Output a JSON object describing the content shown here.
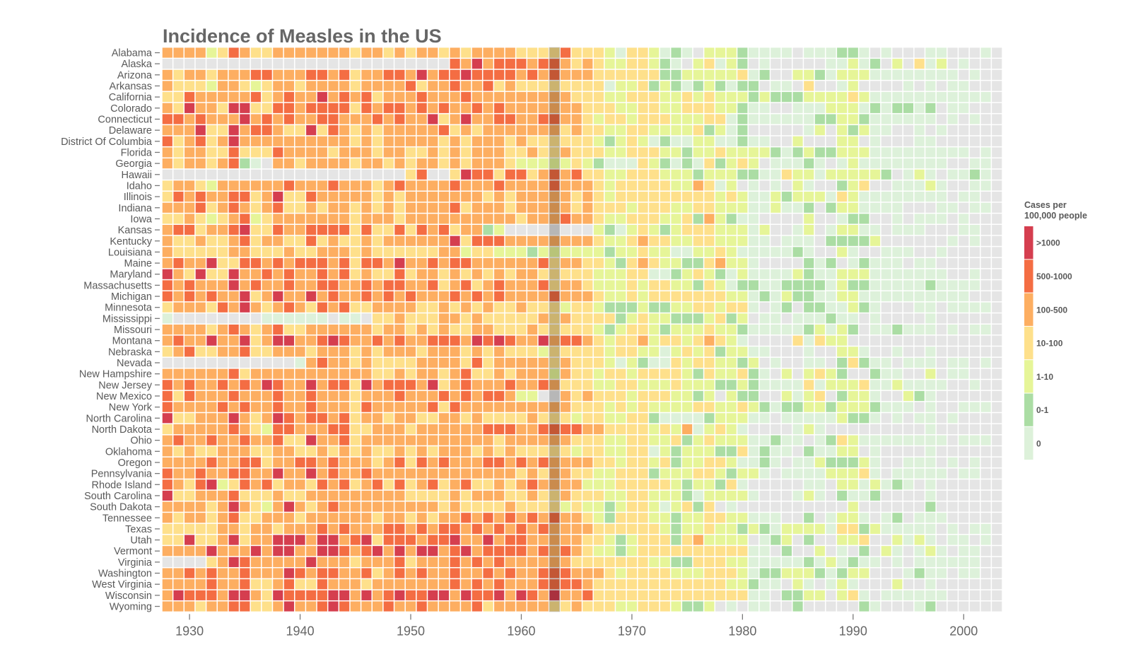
{
  "chart_data": {
    "type": "heatmap",
    "title": "Incidence of Measles in the US",
    "xlabel": "",
    "ylabel": "",
    "year_start": 1928,
    "year_end": 2003,
    "x_ticks": [
      1930,
      1940,
      1950,
      1960,
      1970,
      1980,
      1990,
      2000
    ],
    "highlight_year": 1963,
    "missing": {
      "code": "x",
      "color": "#e5e5e5"
    },
    "legend": {
      "title_lines": [
        "Cases per",
        "100,000 people"
      ],
      "placement": "right",
      "items": [
        {
          "code": "6",
          "label": ">1000",
          "color": "#d53e4f"
        },
        {
          "code": "5",
          "label": "500-1000",
          "color": "#f46d43"
        },
        {
          "code": "4",
          "label": "100-500",
          "color": "#fdae61"
        },
        {
          "code": "3",
          "label": "10-100",
          "color": "#fee08b"
        },
        {
          "code": "2",
          "label": "1-10",
          "color": "#e6f598"
        },
        {
          "code": "1",
          "label": "0-1",
          "color": "#abdda4"
        },
        {
          "code": "0",
          "label": "0",
          "color": "#ddf1da"
        }
      ]
    },
    "rows": [
      {
        "state": "Alabama",
        "values": "444423543344444443443434434344443333533320332010x22210000x000110x0xxx00xxx0x"
      },
      {
        "state": "Alaska",
        "values": "xxxxxxxxxxxxxxxxxxxxxxxxxx546455545543432233210x23021x0xxxxx00201x2x302x0xxx"
      },
      {
        "state": "Arizona",
        "values": "4344344455444554534455464556555545454443333331122222301xx221022200000000x0xx"
      },
      {
        "state": "Arkansas",
        "values": "433324432344344443444453445445343333333302231210121011x00x3xx02xxxx0x0x00xxx"
      },
      {
        "state": "California",
        "values": "335444445345446454534445444544444444433322333223232221211122223200000000000x"
      },
      {
        "state": "Colorado",
        "values": "4364436633554555535455454544545444444433322332233322100xx0002220101101x00xxx"
      },
      {
        "state": "Connecticut",
        "values": "5545444645454455444545446346445544554432332333222330100000011221000000x0x0xx"
      },
      {
        "state": "Delaware",
        "values": "44463364554336354343444445343444444434332233222231201xxxxx02x21200xx0x0xxxxx"
      },
      {
        "state": "District Of Columbia",
        "values": "5345346444444444434344444343444343333332123201002200100xx2xxx22x0xxx00xxxxxx"
      },
      {
        "state": "Florida",
        "values": "4344335333544443444344334343444334334333223332212232222101211222000000000x0x"
      },
      {
        "state": "Georgia",
        "values": "434434510x44344443443434434344432222232100032101031232x00010x0200000000xx00x"
      },
      {
        "state": "Hawaii",
        "values": "xxxxxxxxxxxxxxxxxxxxxx35xx3655355345453322333222122211003220222221x020x0010x"
      },
      {
        "state": "Idaho",
        "values": "3443244444454445444345444454445444454443233333224302x0x0x20xx123xx00020xx00x"
      },
      {
        "state": "Illinois",
        "values": "35454455346335444443434444444343444443432333333333232002122203200000000x00xx"
      },
      {
        "state": "Indiana",
        "values": "44453454345334344343434444534443444443433323332233222002001x1220000xxx00x00x"
      },
      {
        "state": "Iowa",
        "values": "334323452344444443444344444444443444544322333223142100xxxx2xx011xx0x000x0xxx"
      },
      {
        "state": "Kansas",
        "values": "4553445633544555535335354534412xxxxxxxx2102321233322202xx02x02200x000xxx00xx"
      },
      {
        "state": "Kentucky",
        "values": "4334334534433534334344444463555444444443223433223322200x000x11112xxxxxx0x0xx"
      },
      {
        "state": "Louisiana",
        "values": "43333344333433444343333334423322212222221223220022320000010xx20xx000xx0xxxxx"
      },
      {
        "state": "Maine",
        "values": "454463355454555453554644545544444453443321343221134220xxxx101x01000x00xxxxxx"
      },
      {
        "state": "Maryland",
        "values": "64363364454544545343353443434343443333322233001232102000021002220000000xx0xx"
      },
      {
        "state": "Massachusetts",
        "values": "54544464544544554454554453453454445344322232332213201100111102110000010000xx"
      },
      {
        "state": "Michigan",
        "values": "5454544634644645445454544454545444454443223233333332201021100220000000000xxx"
      },
      {
        "state": "Minnesota",
        "values": "344435464345435453344443343434334333233211121122332330x01x1100210xxx00x0000x"
      },
      {
        "state": "Mississippi",
        "values": "0xxxxxxxx000000x00x3343334434333334343333123221112312x00x000100x0xxxx0xxxxxx"
      },
      {
        "state": "Missouri",
        "values": "444434543453344444434434343344333433333212332122232210000012021x001000x0x00x"
      },
      {
        "state": "Montana",
        "values": "45446446346644565445454455546565446455432334233234320xxxx30322xxxxxxxxxxxxxx"
      },
      {
        "state": "Nebraska",
        "values": "3453344533444344434344434443434333233333233220232312200xxx0xx220xx0xx0xxxxxx"
      },
      {
        "state": "Nevada",
        "values": "xxxxxxxxxxxx045443433334444353444443433320210032332212x0xx00x13100x000x00x0x"
      },
      {
        "state": "New Hampshire",
        "values": "4444445344444444444334344345334344424332332333321322310x2x2321xx100xx2x00xxx"
      },
      {
        "state": "New Jersey",
        "values": "54544545465446455364555463454445445433322332223222112100003022230020000xx0xx"
      },
      {
        "state": "New Mexico",
        "values": "5354445444544544434445444545455422xx43433323332212x211xx2023x1220xx210xxxxxx"
      },
      {
        "state": "New York",
        "values": "54444545445445444354444453544444444443332323222233223210112212221000x0xx000x"
      },
      {
        "state": "North Carolina",
        "values": "6334446434654554534434433443433334333233223310000122200x000002110x0x00x0xxxx"
      },
      {
        "state": "North Dakota",
        "values": "34444454325544455334443444444555445555443333232402320xxxx020xxxxxxxxx0xxxxxx"
      },
      {
        "state": "Ohio",
        "values": "4544544544533644534444444444443444444333223322312322200100x013200000000x000x"
      },
      {
        "state": "Oklahoma",
        "values": "434334443344334343433434344434343333323322330212221130100x10022x0xxxx0xxxxxx"
      },
      {
        "state": "Oregon",
        "values": "44445445534455454443453545444554545444433233231223320010x00211120xx000x0x0xx"
      },
      {
        "state": "Pennsylvania",
        "values": "5445445544644645445444444444444434344332233312223321220x000022230x00000x00xx"
      },
      {
        "state": "Rhode Island",
        "values": "54356235453443545345353453453343454444222333332122130xxxxx00x2202010x0xxxxxx"
      },
      {
        "state": "South Carolina",
        "values": "633444533343344444444433334344433433433322332221022220xxx020x1001xxxx0xxxxxx"
      },
      {
        "state": "South Dakota",
        "values": "44443464324643454444444443433334333323221233202313x0xxxxxxxxxx2xxxxxx1xxxxxx"
      },
      {
        "state": "Tennessee",
        "values": "43443453344434444443443434454545454544321333221223322000xx1x0220x01x000xxxxx"
      },
      {
        "state": "Texas",
        "values": "3333344344344454544455454554545454544443333332122322121022220331200000x0x00x"
      },
      {
        "state": "Utah",
        "values": "33633463446664664563555455644645544444332123331342222x012x1xx223xx2020x00x0x"
      },
      {
        "state": "Vermont",
        "values": "4444644464664466545646466456455554545432212333333333300x1xx2x0x1x20x020x00xx"
      },
      {
        "state": "Virginia",
        "values": "xxxx3465444446444344453444545454444443333333221133322000001020100x0x000000xx"
      },
      {
        "state": "Washington",
        "values": "4454544544465455445345454454454544555444323333222333201122210122xxx0100x00xx"
      },
      {
        "state": "West Virginia",
        "values": "44445445334533544434444444545454445555433333333333322100x20x020xxx2xx0xxxxxx"
      },
      {
        "state": "Wisconsin",
        "values": "4655546643655556646456556646556465464453333333333333300x1122x230x000000xxxxx"
      },
      {
        "state": "Wyoming",
        "values": "44434455334644565444544544445344444334333223332112x0x00xx1xxxxx10xxx01xxxxxx"
      }
    ]
  }
}
